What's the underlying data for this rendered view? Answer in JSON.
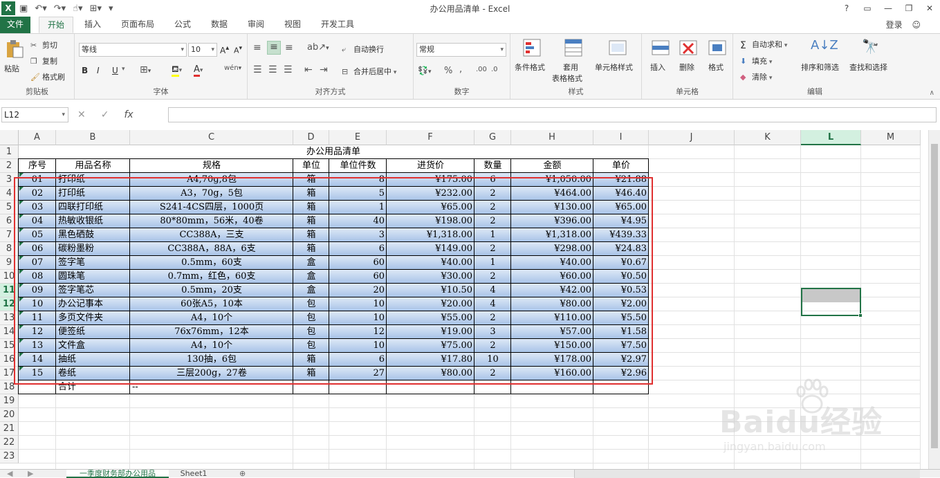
{
  "app": {
    "title": "办公用品清单 - Excel",
    "login": "登录",
    "help": "?"
  },
  "tabs": [
    "文件",
    "开始",
    "插入",
    "页面布局",
    "公式",
    "数据",
    "审阅",
    "视图",
    "开发工具"
  ],
  "clipboard": {
    "paste": "粘贴",
    "cut": "剪切",
    "copy": "复制",
    "painter": "格式刷",
    "label": "剪贴板"
  },
  "font": {
    "name": "等线",
    "size": "10",
    "bold": "B",
    "italic": "I",
    "underline": "U",
    "label": "字体"
  },
  "align": {
    "wrap": "自动换行",
    "merge": "合并后居中",
    "label": "对齐方式"
  },
  "number": {
    "format": "常规",
    "label": "数字"
  },
  "styles": {
    "cond": "条件格式",
    "table1": "套用",
    "table2": "表格格式",
    "cell": "单元格样式",
    "label": "样式"
  },
  "cells": {
    "insert": "插入",
    "delete": "删除",
    "format": "格式",
    "label": "单元格"
  },
  "edit": {
    "autosum": "自动求和",
    "fill": "填充",
    "clear": "清除",
    "sort": "排序和筛选",
    "find": "查找和选择",
    "label": "编辑"
  },
  "namebox": "L12",
  "columns": [
    "A",
    "B",
    "C",
    "D",
    "E",
    "F",
    "G",
    "H",
    "I",
    "J",
    "K",
    "L",
    "M"
  ],
  "rows": [
    "1",
    "2",
    "3",
    "4",
    "5",
    "6",
    "7",
    "8",
    "9",
    "10",
    "11",
    "12",
    "13",
    "14",
    "15",
    "16",
    "17",
    "18",
    "19",
    "20",
    "21",
    "22",
    "23"
  ],
  "sheet": {
    "title": "办公用品清单",
    "headers": [
      "序号",
      "用品名称",
      "规格",
      "单位",
      "单位件数",
      "进货价",
      "数量",
      "金额",
      "单价"
    ],
    "data": [
      [
        "01",
        "打印纸",
        "A4,70g,8包",
        "箱",
        "8",
        "¥175.00",
        "6",
        "¥1,050.00",
        "¥21.88"
      ],
      [
        "02",
        "打印纸",
        "A3，70g，5包",
        "箱",
        "5",
        "¥232.00",
        "2",
        "¥464.00",
        "¥46.40"
      ],
      [
        "03",
        "四联打印纸",
        "S241-4CS四层，1000页",
        "箱",
        "1",
        "¥65.00",
        "2",
        "¥130.00",
        "¥65.00"
      ],
      [
        "04",
        "热敏收银纸",
        "80*80mm，56米，40卷",
        "箱",
        "40",
        "¥198.00",
        "2",
        "¥396.00",
        "¥4.95"
      ],
      [
        "05",
        "黑色硒鼓",
        "CC388A，三支",
        "箱",
        "3",
        "¥1,318.00",
        "1",
        "¥1,318.00",
        "¥439.33"
      ],
      [
        "06",
        "碳粉墨粉",
        "CC388A，88A，6支",
        "箱",
        "6",
        "¥149.00",
        "2",
        "¥298.00",
        "¥24.83"
      ],
      [
        "07",
        "签字笔",
        "0.5mm，60支",
        "盒",
        "60",
        "¥40.00",
        "1",
        "¥40.00",
        "¥0.67"
      ],
      [
        "08",
        "圆珠笔",
        "0.7mm，红色，60支",
        "盒",
        "60",
        "¥30.00",
        "2",
        "¥60.00",
        "¥0.50"
      ],
      [
        "09",
        "签字笔芯",
        "0.5mm，20支",
        "盒",
        "20",
        "¥10.50",
        "4",
        "¥42.00",
        "¥0.53"
      ],
      [
        "10",
        "办公记事本",
        "60张A5，10本",
        "包",
        "10",
        "¥20.00",
        "4",
        "¥80.00",
        "¥2.00"
      ],
      [
        "11",
        "多页文件夹",
        "A4，10个",
        "包",
        "10",
        "¥55.00",
        "2",
        "¥110.00",
        "¥5.50"
      ],
      [
        "12",
        "便签纸",
        "76x76mm，12本",
        "包",
        "12",
        "¥19.00",
        "3",
        "¥57.00",
        "¥1.58"
      ],
      [
        "13",
        "文件盒",
        "A4，10个",
        "包",
        "10",
        "¥75.00",
        "2",
        "¥150.00",
        "¥7.50"
      ],
      [
        "14",
        "抽纸",
        "130抽，6包",
        "箱",
        "6",
        "¥17.80",
        "10",
        "¥178.00",
        "¥2.97"
      ],
      [
        "15",
        "卷纸",
        "三层200g，27卷",
        "箱",
        "27",
        "¥80.00",
        "2",
        "¥160.00",
        "¥2.96"
      ]
    ],
    "total_label": "合计",
    "total_value": "--"
  },
  "sheets": [
    "一季度财务部办公用品",
    "Sheet1"
  ],
  "watermark": {
    "big": "Baidu经验",
    "small": "jingyan.baidu.com"
  },
  "colors": {
    "accent": "#217346",
    "highlight": "#e03030",
    "row_fill_top": "#dde8f6",
    "row_fill_bottom": "#a9c4e8"
  }
}
